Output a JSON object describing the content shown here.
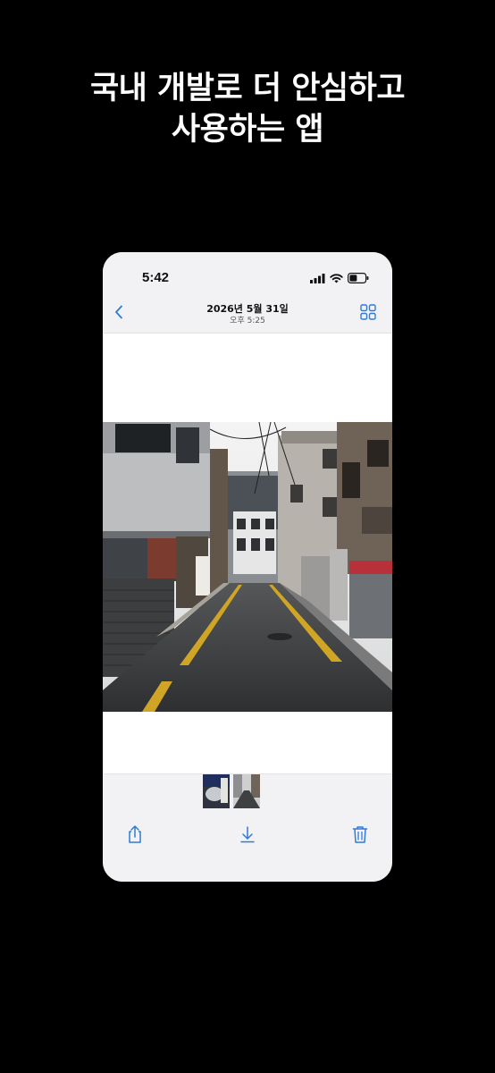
{
  "headline": {
    "line1": "국내 개발로 더 안심하고",
    "line2": "사용하는 앱"
  },
  "status_bar": {
    "time": "5:42",
    "icons": [
      "cellular-signal-icon",
      "wifi-icon",
      "battery-icon"
    ]
  },
  "nav": {
    "title": "2026년 5월 31일",
    "subtitle": "오후 5:25",
    "back_icon": "chevron-left-icon",
    "grid_icon": "grid-icon"
  },
  "photo": {
    "subject": "street-alley-photo"
  },
  "thumbnails": {
    "count": 2
  },
  "toolbar": {
    "icons": [
      "share-icon",
      "download-icon",
      "trash-icon"
    ]
  },
  "colors": {
    "background": "#000000",
    "accent": "#2f7bd8",
    "phone_bar": "#f2f2f4"
  }
}
